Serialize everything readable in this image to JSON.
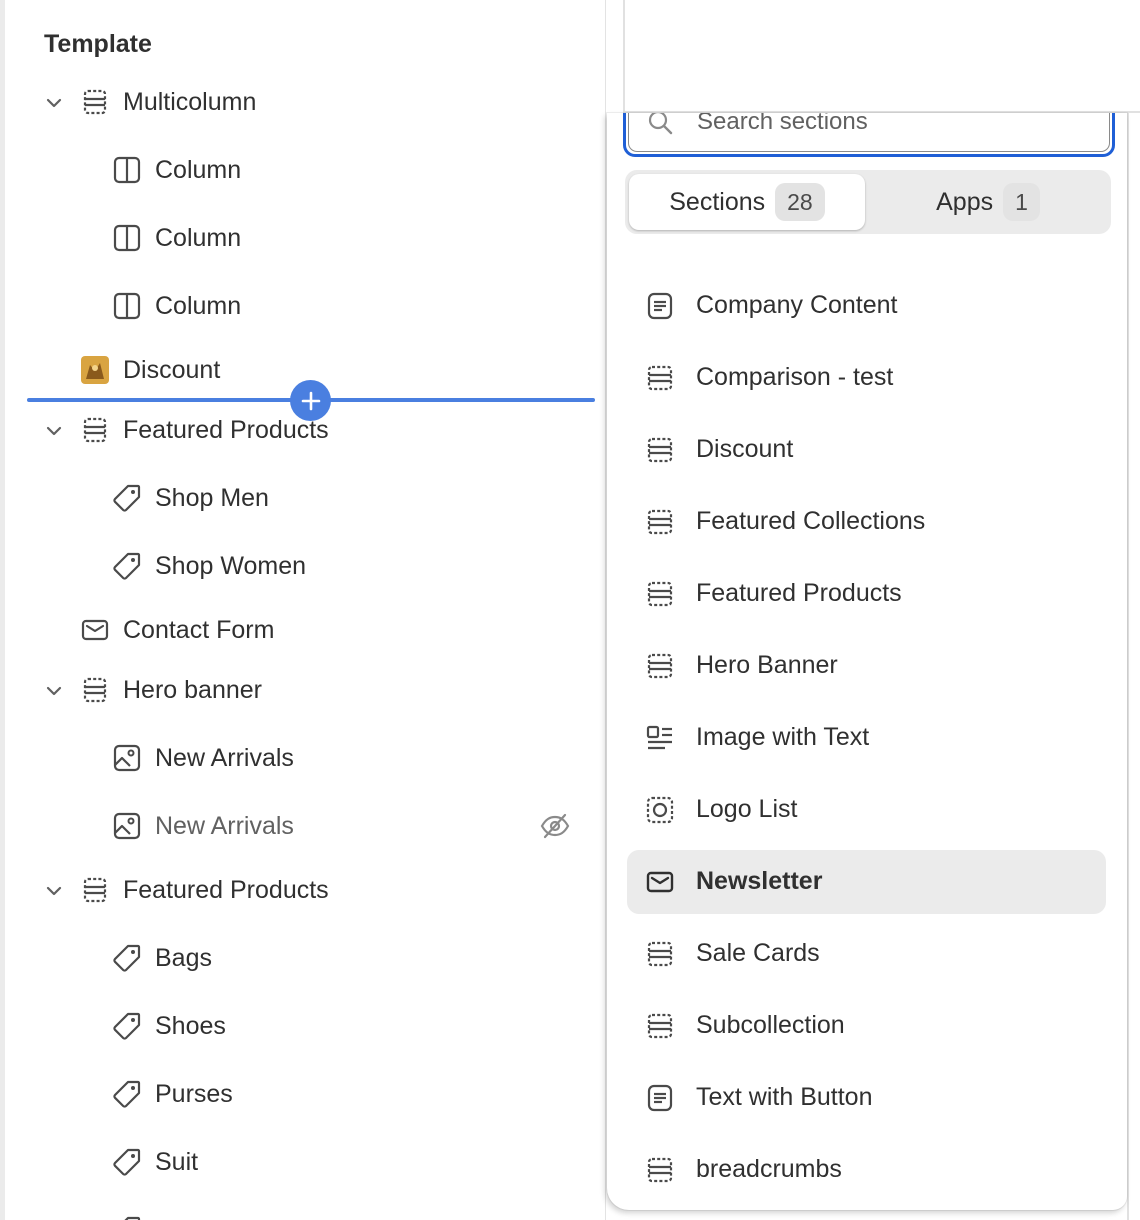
{
  "template": {
    "title": "Template",
    "rows": [
      {
        "label": "Multicolumn",
        "icon": "section-icon",
        "level": 0,
        "expandable": true
      },
      {
        "label": "Column",
        "icon": "column-icon",
        "level": 1
      },
      {
        "label": "Column",
        "icon": "column-icon",
        "level": 1
      },
      {
        "label": "Column",
        "icon": "column-icon",
        "level": 1
      },
      {
        "label": "Discount",
        "icon": "app-thumbnail-icon",
        "level": 0
      },
      {
        "label": "Featured Products",
        "icon": "section-icon",
        "level": 0,
        "expandable": true
      },
      {
        "label": "Shop Men",
        "icon": "tag-icon",
        "level": 1
      },
      {
        "label": "Shop Women",
        "icon": "tag-icon",
        "level": 1
      },
      {
        "label": "Contact Form",
        "icon": "mail-icon",
        "level": 0
      },
      {
        "label": "Hero banner",
        "icon": "section-icon",
        "level": 0,
        "expandable": true
      },
      {
        "label": "New Arrivals",
        "icon": "image-icon",
        "level": 1
      },
      {
        "label": "New Arrivals",
        "icon": "image-icon",
        "level": 1,
        "hidden": true
      },
      {
        "label": "Featured Products",
        "icon": "section-icon",
        "level": 0,
        "expandable": true
      },
      {
        "label": "Bags",
        "icon": "tag-icon",
        "level": 1
      },
      {
        "label": "Shoes",
        "icon": "tag-icon",
        "level": 1
      },
      {
        "label": "Purses",
        "icon": "tag-icon",
        "level": 1
      },
      {
        "label": "Suit",
        "icon": "tag-icon",
        "level": 1
      }
    ]
  },
  "picker": {
    "search_placeholder": "Search sections",
    "tabs": [
      {
        "label": "Sections",
        "count": "28",
        "active": true
      },
      {
        "label": "Apps",
        "count": "1",
        "active": false
      }
    ],
    "sections": [
      {
        "label": "Company Content",
        "icon": "text-block-icon"
      },
      {
        "label": "Comparison - test",
        "icon": "section-icon"
      },
      {
        "label": "Discount",
        "icon": "section-icon"
      },
      {
        "label": "Featured Collections",
        "icon": "section-icon"
      },
      {
        "label": "Featured Products",
        "icon": "section-icon"
      },
      {
        "label": "Hero Banner",
        "icon": "section-icon"
      },
      {
        "label": "Image with Text",
        "icon": "image-text-icon"
      },
      {
        "label": "Logo List",
        "icon": "logo-icon"
      },
      {
        "label": "Newsletter",
        "icon": "mail-icon",
        "hovered": true
      },
      {
        "label": "Sale Cards",
        "icon": "section-icon"
      },
      {
        "label": "Subcollection",
        "icon": "section-icon"
      },
      {
        "label": "Text with Button",
        "icon": "text-block-icon"
      },
      {
        "label": "breadcrumbs",
        "icon": "section-icon"
      }
    ]
  },
  "colors": {
    "accent": "#1f5fd6",
    "insert_indicator": "#4a7fe0",
    "hover_bg": "#ebebeb",
    "text": "#303030"
  }
}
